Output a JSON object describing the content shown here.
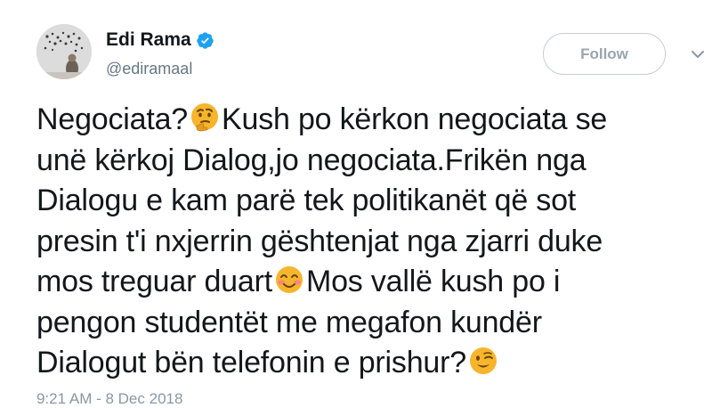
{
  "author": {
    "name": "Edi Rama",
    "handle": "@ediramaal",
    "verified": true
  },
  "follow_button": {
    "label": "Follow"
  },
  "tweet": {
    "lines": [
      [
        "Negociata?",
        {
          "emoji": "thinking-face"
        },
        "Kush po kërkon negociata se"
      ],
      [
        "unë kërkoj Dialog,jo negociata.Frikën nga"
      ],
      [
        "Dialogu e kam parë tek politikanët që sot"
      ],
      [
        "presin t'i nxjerrin gështenjat nga zjarri duke"
      ],
      [
        "mos treguar duart",
        {
          "emoji": "smiling-face-with-smiling-eyes"
        },
        "Mos vallë kush po i"
      ],
      [
        "pengon studentët me megafon kundër"
      ],
      [
        "Dialogut bën telefonin e prishur?",
        {
          "emoji": "winking-face"
        }
      ]
    ]
  },
  "timestamp": "9:21 AM - 8 Dec 2018",
  "colors": {
    "verified": "#1da1f2",
    "secondary_text": "#657786",
    "follow_border": "#c7ced4",
    "follow_text": "#9aa5ae",
    "emoji_face": "#f7b52c"
  }
}
